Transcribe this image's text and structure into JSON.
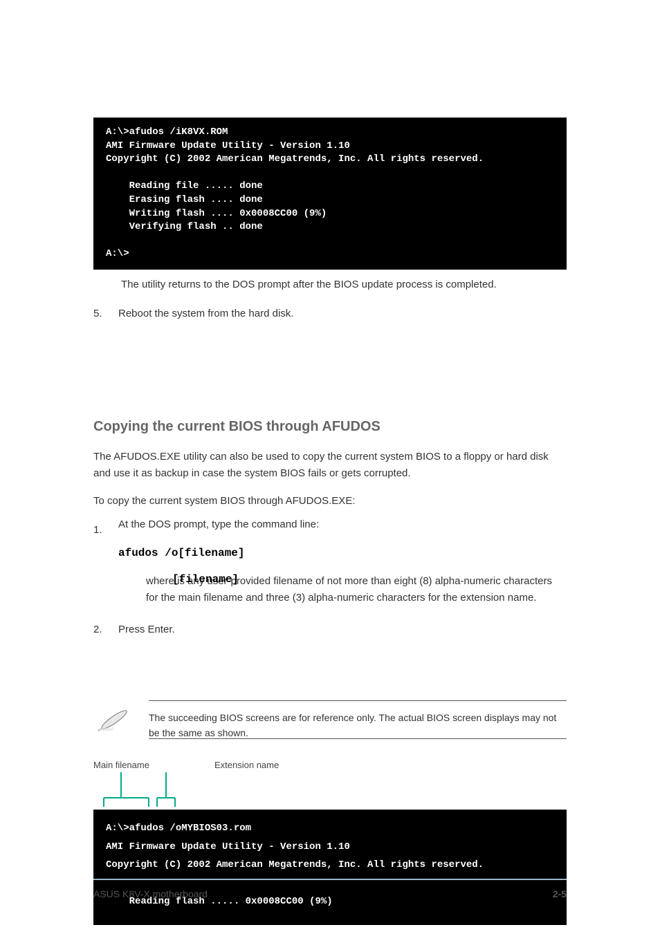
{
  "terminal1": {
    "line1": "A:\\>afudos /iK8VX.ROM",
    "line2": "AMI Firmware Update Utility - Version 1.10",
    "line3": "Copyright (C) 2002 American Megatrends, Inc. All rights reserved.",
    "blank": "",
    "line4": "    Reading file ..... done",
    "line5": "    Erasing flash .... done",
    "line6": "    Writing flash .... 0x0008CC00 (9%)",
    "line7": "    Verifying flash .. done",
    "line8": "A:\\>"
  },
  "para1": "The utility returns to the DOS prompt after the BIOS update process is completed.",
  "step5": "Reboot the system from the hard disk.",
  "step5_num": "5.",
  "section_heading": "Copying the current BIOS through AFUDOS",
  "para2": "The AFUDOS.EXE utility can also be used to copy the current system BIOS to a floppy or hard disk and use it as backup in case the system BIOS fails or gets corrupted.",
  "copy_intro": "To copy the current system BIOS through AFUDOS.EXE:",
  "step1_num": "1.",
  "step1": "At the DOS prompt, type the command line:",
  "cmd": "afudos /o[filename]",
  "filename_label": "[filename]",
  "filename_desc": "where                       is any user-provided filename of not more than eight (8) alpha-numeric characters for the main filename and three (3) alpha-numeric characters for the extension name.",
  "step2_num": "2.",
  "step2": "Press Enter.",
  "note": "The succeeding BIOS screens are for reference only. The actual BIOS screen displays may not be the same as shown.",
  "diagram": {
    "left_label": "Main filename",
    "right_label": "Extension name"
  },
  "terminal2": {
    "line1": "A:\\>afudos /oMYBIOS03.rom",
    "line2": "AMI Firmware Update Utility - Version 1.10",
    "line3": "Copyright (C) 2002 American Megatrends, Inc. All rights reserved.",
    "line4": "    Reading flash ..... 0x0008CC00 (9%)"
  },
  "footer": {
    "left": "ASUS K8V-X motherboard",
    "right": "2-5"
  }
}
